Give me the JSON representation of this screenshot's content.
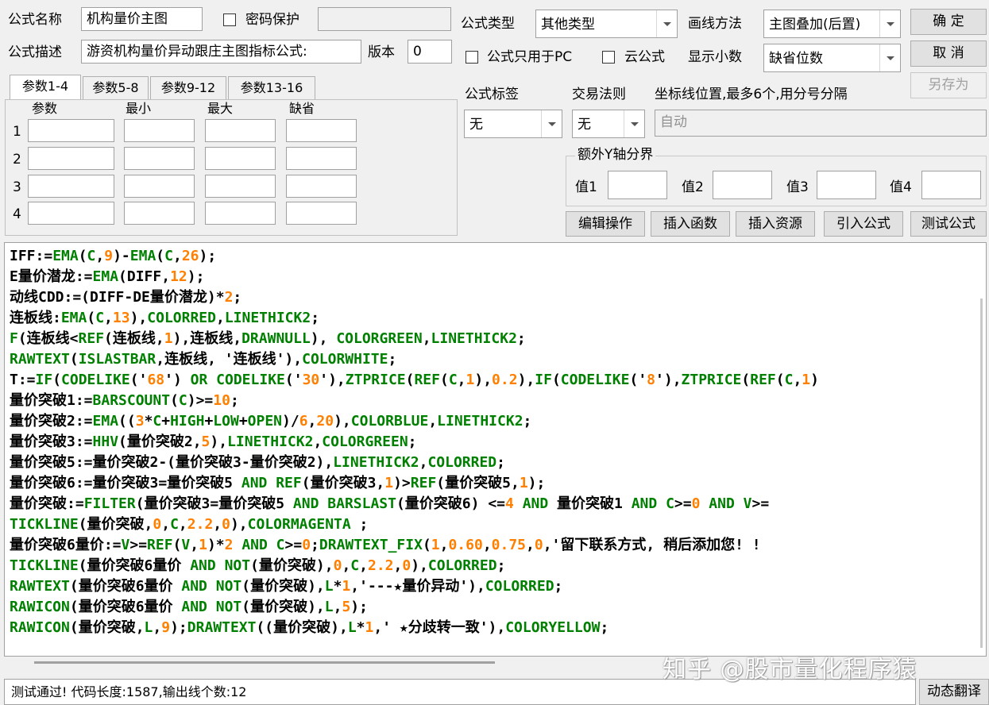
{
  "header": {
    "formula_name_label": "公式名称",
    "formula_name_value": "机构量价主图",
    "password_label": "密码保护",
    "formula_desc_label": "公式描述",
    "formula_desc_value": "游资机构量价异动跟庄主图指标公式:",
    "version_label": "版本",
    "version_value": "0",
    "formula_type_label": "公式类型",
    "formula_type_value": "其他类型",
    "draw_method_label": "画线方法",
    "draw_method_value": "主图叠加(后置)",
    "pc_only_label": "公式只用于PC",
    "cloud_label": "云公式",
    "decimals_label": "显示小数",
    "decimals_value": "缺省位数",
    "ok_label": "确  定",
    "cancel_label": "取  消",
    "save_as_label": "另存为"
  },
  "params": {
    "tabs": [
      "参数1-4",
      "参数5-8",
      "参数9-12",
      "参数13-16"
    ],
    "columns": [
      "参数",
      "最小",
      "最大",
      "缺省"
    ],
    "rows": [
      "1",
      "2",
      "3",
      "4"
    ]
  },
  "right_panel": {
    "tag_label": "公式标签",
    "tag_value": "无",
    "trade_rule_label": "交易法则",
    "trade_rule_value": "无",
    "axis_label": "坐标线位置,最多6个,用分号分隔",
    "axis_placeholder": "自动",
    "extra_y_label": "额外Y轴分界",
    "values": [
      "值1",
      "值2",
      "值3",
      "值4"
    ]
  },
  "toolbar": {
    "edit_ops": "编辑操作",
    "insert_func": "插入函数",
    "insert_res": "插入资源",
    "import_formula": "引入公式",
    "test_formula": "测试公式"
  },
  "code_lines": [
    [
      [
        "IFF:=",
        "w"
      ],
      [
        "EMA",
        "g"
      ],
      [
        "(",
        "w"
      ],
      [
        "C",
        "g"
      ],
      [
        ",",
        "w"
      ],
      [
        "9",
        "o"
      ],
      [
        ")-",
        "w"
      ],
      [
        "EMA",
        "g"
      ],
      [
        "(",
        "w"
      ],
      [
        "C",
        "g"
      ],
      [
        ",",
        "w"
      ],
      [
        "26",
        "o"
      ],
      [
        ");",
        "w"
      ]
    ],
    [
      [
        "E量价潜龙:=",
        "w"
      ],
      [
        "EMA",
        "g"
      ],
      [
        "(DIFF,",
        "w"
      ],
      [
        "12",
        "o"
      ],
      [
        ");",
        "w"
      ]
    ],
    [
      [
        "动线CDD:=(DIFF-DE量价潜龙)*",
        "w"
      ],
      [
        "2",
        "o"
      ],
      [
        ";",
        "w"
      ]
    ],
    [
      [
        "连板线:",
        "w"
      ],
      [
        "EMA",
        "g"
      ],
      [
        "(",
        "w"
      ],
      [
        "C",
        "g"
      ],
      [
        ",",
        "w"
      ],
      [
        "13",
        "o"
      ],
      [
        "),",
        "w"
      ],
      [
        "COLORRED",
        "g"
      ],
      [
        ",",
        "w"
      ],
      [
        "LINETHICK2",
        "g"
      ],
      [
        ";",
        "w"
      ]
    ],
    [
      [
        "F",
        "g"
      ],
      [
        "(连板线<",
        "w"
      ],
      [
        "REF",
        "g"
      ],
      [
        "(连板线,",
        "w"
      ],
      [
        "1",
        "o"
      ],
      [
        "),连板线,",
        "w"
      ],
      [
        "DRAWNULL",
        "g"
      ],
      [
        "), ",
        "w"
      ],
      [
        "COLORGREEN",
        "g"
      ],
      [
        ",",
        "w"
      ],
      [
        "LINETHICK2",
        "g"
      ],
      [
        ";",
        "w"
      ]
    ],
    [
      [
        "RAWTEXT",
        "g"
      ],
      [
        "(",
        "w"
      ],
      [
        "ISLASTBAR",
        "g"
      ],
      [
        ",连板线, '连板线'),",
        "w"
      ],
      [
        "COLORWHITE",
        "g"
      ],
      [
        ";",
        "w"
      ]
    ],
    [
      [
        "T:=",
        "w"
      ],
      [
        "IF",
        "g"
      ],
      [
        "(",
        "w"
      ],
      [
        "CODELIKE",
        "g"
      ],
      [
        "('",
        "w"
      ],
      [
        "68",
        "o"
      ],
      [
        "') ",
        "w"
      ],
      [
        "OR",
        "g"
      ],
      [
        " ",
        "w"
      ],
      [
        "CODELIKE",
        "g"
      ],
      [
        "('",
        "w"
      ],
      [
        "30",
        "o"
      ],
      [
        "'),",
        "w"
      ],
      [
        "ZTPRICE",
        "g"
      ],
      [
        "(",
        "w"
      ],
      [
        "REF",
        "g"
      ],
      [
        "(",
        "w"
      ],
      [
        "C",
        "g"
      ],
      [
        ",",
        "w"
      ],
      [
        "1",
        "o"
      ],
      [
        "),",
        "w"
      ],
      [
        "0.2",
        "o"
      ],
      [
        "),",
        "w"
      ],
      [
        "IF",
        "g"
      ],
      [
        "(",
        "w"
      ],
      [
        "CODELIKE",
        "g"
      ],
      [
        "('",
        "w"
      ],
      [
        "8",
        "o"
      ],
      [
        "'),",
        "w"
      ],
      [
        "ZTPRICE",
        "g"
      ],
      [
        "(",
        "w"
      ],
      [
        "REF",
        "g"
      ],
      [
        "(",
        "w"
      ],
      [
        "C",
        "g"
      ],
      [
        ",",
        "w"
      ],
      [
        "1",
        "o"
      ],
      [
        ")",
        "w"
      ]
    ],
    [
      [
        "量价突破1:=",
        "w"
      ],
      [
        "BARSCOUNT",
        "g"
      ],
      [
        "(",
        "w"
      ],
      [
        "C",
        "g"
      ],
      [
        ")>=",
        "w"
      ],
      [
        "10",
        "o"
      ],
      [
        ";",
        "w"
      ]
    ],
    [
      [
        "量价突破2:=",
        "w"
      ],
      [
        "EMA",
        "g"
      ],
      [
        "((",
        "w"
      ],
      [
        "3",
        "o"
      ],
      [
        "*",
        "w"
      ],
      [
        "C",
        "g"
      ],
      [
        "+",
        "w"
      ],
      [
        "HIGH",
        "g"
      ],
      [
        "+",
        "w"
      ],
      [
        "LOW",
        "g"
      ],
      [
        "+",
        "w"
      ],
      [
        "OPEN",
        "g"
      ],
      [
        ")/",
        "w"
      ],
      [
        "6",
        "o"
      ],
      [
        ",",
        "w"
      ],
      [
        "20",
        "o"
      ],
      [
        "),",
        "w"
      ],
      [
        "COLORBLUE",
        "g"
      ],
      [
        ",",
        "w"
      ],
      [
        "LINETHICK2",
        "g"
      ],
      [
        ";",
        "w"
      ]
    ],
    [
      [
        "量价突破3:=",
        "w"
      ],
      [
        "HHV",
        "g"
      ],
      [
        "(量价突破2,",
        "w"
      ],
      [
        "5",
        "o"
      ],
      [
        "),",
        "w"
      ],
      [
        "LINETHICK2",
        "g"
      ],
      [
        ",",
        "w"
      ],
      [
        "COLORGREEN",
        "g"
      ],
      [
        ";",
        "w"
      ]
    ],
    [
      [
        "量价突破5:=量价突破2-(量价突破3-量价突破2),",
        "w"
      ],
      [
        "LINETHICK2",
        "g"
      ],
      [
        ",",
        "w"
      ],
      [
        "COLORRED",
        "g"
      ],
      [
        ";",
        "w"
      ]
    ],
    [
      [
        "量价突破6:=量价突破3=量价突破5 ",
        "w"
      ],
      [
        "AND",
        "g"
      ],
      [
        " ",
        "w"
      ],
      [
        "REF",
        "g"
      ],
      [
        "(量价突破3,",
        "w"
      ],
      [
        "1",
        "o"
      ],
      [
        ")>",
        "w"
      ],
      [
        "REF",
        "g"
      ],
      [
        "(量价突破5,",
        "w"
      ],
      [
        "1",
        "o"
      ],
      [
        ");",
        "w"
      ]
    ],
    [
      [
        "量价突破:=",
        "w"
      ],
      [
        "FILTER",
        "g"
      ],
      [
        "(量价突破3=量价突破5 ",
        "w"
      ],
      [
        "AND",
        "g"
      ],
      [
        " ",
        "w"
      ],
      [
        "BARSLAST",
        "g"
      ],
      [
        "(量价突破6) <=",
        "w"
      ],
      [
        "4",
        "o"
      ],
      [
        " ",
        "w"
      ],
      [
        "AND",
        "g"
      ],
      [
        " 量价突破1 ",
        "w"
      ],
      [
        "AND",
        "g"
      ],
      [
        " ",
        "w"
      ],
      [
        "C",
        "g"
      ],
      [
        ">=",
        "w"
      ],
      [
        "0",
        "o"
      ],
      [
        " ",
        "w"
      ],
      [
        "AND",
        "g"
      ],
      [
        " ",
        "w"
      ],
      [
        "V",
        "g"
      ],
      [
        ">=",
        "w"
      ]
    ],
    [
      [
        "TICKLINE",
        "g"
      ],
      [
        "(量价突破,",
        "w"
      ],
      [
        "0",
        "o"
      ],
      [
        ",",
        "w"
      ],
      [
        "C",
        "g"
      ],
      [
        ",",
        "w"
      ],
      [
        "2.2",
        "o"
      ],
      [
        ",",
        "w"
      ],
      [
        "0",
        "o"
      ],
      [
        "),",
        "w"
      ],
      [
        "COLORMAGENTA",
        "g"
      ],
      [
        " ;",
        "w"
      ]
    ],
    [
      [
        "量价突破6量价:=",
        "w"
      ],
      [
        "V",
        "g"
      ],
      [
        ">=",
        "w"
      ],
      [
        "REF",
        "g"
      ],
      [
        "(",
        "w"
      ],
      [
        "V",
        "g"
      ],
      [
        ",",
        "w"
      ],
      [
        "1",
        "o"
      ],
      [
        ")*",
        "w"
      ],
      [
        "2",
        "o"
      ],
      [
        " ",
        "w"
      ],
      [
        "AND",
        "g"
      ],
      [
        " ",
        "w"
      ],
      [
        "C",
        "g"
      ],
      [
        ">=",
        "w"
      ],
      [
        "0",
        "o"
      ],
      [
        ";",
        "w"
      ],
      [
        "DRAWTEXT_FIX",
        "g"
      ],
      [
        "(",
        "w"
      ],
      [
        "1",
        "o"
      ],
      [
        ",",
        "w"
      ],
      [
        "0.60",
        "o"
      ],
      [
        ",",
        "w"
      ],
      [
        "0.75",
        "o"
      ],
      [
        ",",
        "w"
      ],
      [
        "0",
        "o"
      ],
      [
        ",'留下联系方式, 稍后添加您! !",
        "w"
      ]
    ],
    [
      [
        "TICKLINE",
        "g"
      ],
      [
        "(量价突破6量价 ",
        "w"
      ],
      [
        "AND",
        "g"
      ],
      [
        " ",
        "w"
      ],
      [
        "NOT",
        "g"
      ],
      [
        "(量价突破),",
        "w"
      ],
      [
        "0",
        "o"
      ],
      [
        ",",
        "w"
      ],
      [
        "C",
        "g"
      ],
      [
        ",",
        "w"
      ],
      [
        "2.2",
        "o"
      ],
      [
        ",",
        "w"
      ],
      [
        "0",
        "o"
      ],
      [
        "),",
        "w"
      ],
      [
        "COLORRED",
        "g"
      ],
      [
        ";",
        "w"
      ]
    ],
    [
      [
        "RAWTEXT",
        "g"
      ],
      [
        "(量价突破6量价 ",
        "w"
      ],
      [
        "AND",
        "g"
      ],
      [
        " ",
        "w"
      ],
      [
        "NOT",
        "g"
      ],
      [
        "(量价突破),",
        "w"
      ],
      [
        "L",
        "g"
      ],
      [
        "*",
        "w"
      ],
      [
        "1",
        "o"
      ],
      [
        ",'---★量价异动'),",
        "w"
      ],
      [
        "COLORRED",
        "g"
      ],
      [
        ";",
        "w"
      ]
    ],
    [
      [
        "RAWICON",
        "g"
      ],
      [
        "(量价突破6量价 ",
        "w"
      ],
      [
        "AND",
        "g"
      ],
      [
        " ",
        "w"
      ],
      [
        "NOT",
        "g"
      ],
      [
        "(量价突破),",
        "w"
      ],
      [
        "L",
        "g"
      ],
      [
        ",",
        "w"
      ],
      [
        "5",
        "o"
      ],
      [
        ");",
        "w"
      ]
    ],
    [
      [
        "RAWICON",
        "g"
      ],
      [
        "(量价突破,",
        "w"
      ],
      [
        "L",
        "g"
      ],
      [
        ",",
        "w"
      ],
      [
        "9",
        "o"
      ],
      [
        ");",
        "w"
      ],
      [
        "DRAWTEXT",
        "g"
      ],
      [
        "((量价突破),",
        "w"
      ],
      [
        "L",
        "g"
      ],
      [
        "*",
        "w"
      ],
      [
        "1",
        "o"
      ],
      [
        ",' ★分歧转一致'),",
        "w"
      ],
      [
        "COLORYELLOW",
        "g"
      ],
      [
        ";",
        "w"
      ]
    ]
  ],
  "status": {
    "message": "测试通过! 代码长度:1587,输出线个数:12",
    "dynamic_translate": "动态翻译"
  },
  "watermark": "知乎 @股市量化程序猿"
}
